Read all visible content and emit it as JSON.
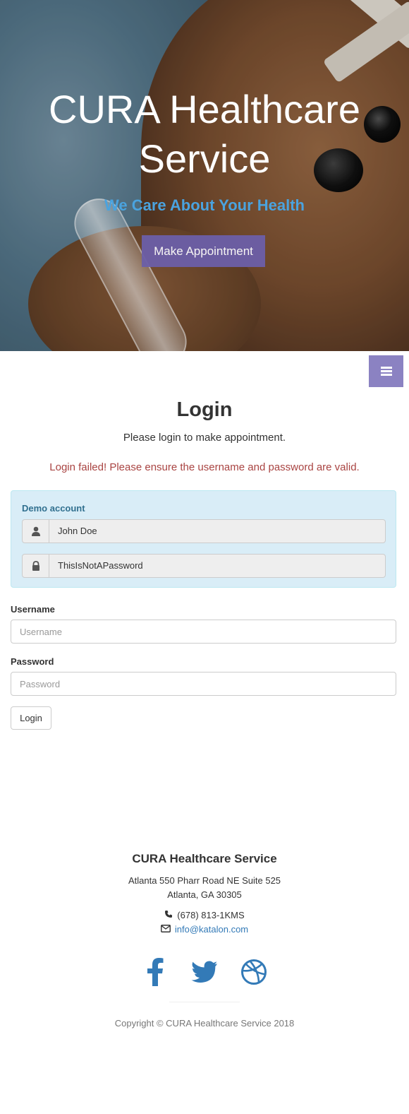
{
  "hero": {
    "title": "CURA Healthcare Service",
    "subtitle": "We Care About Your Health",
    "cta_label": "Make Appointment"
  },
  "login": {
    "title": "Login",
    "lead": "Please login to make appointment.",
    "error": "Login failed! Please ensure the username and password are valid.",
    "demo": {
      "title": "Demo account",
      "username_value": "John Doe",
      "password_value": "ThisIsNotAPassword"
    },
    "username_label": "Username",
    "username_placeholder": "Username",
    "password_label": "Password",
    "password_placeholder": "Password",
    "submit_label": "Login"
  },
  "footer": {
    "title": "CURA Healthcare Service",
    "address_line1": "Atlanta 550 Pharr Road NE Suite 525",
    "address_line2": "Atlanta, GA 30305",
    "phone": "(678) 813-1KMS",
    "email": "info@katalon.com",
    "copyright": "Copyright © CURA Healthcare Service 2018"
  },
  "icons": {
    "menu": "bars-icon",
    "user": "user-icon",
    "lock": "lock-icon",
    "phone": "phone-icon",
    "envelope": "envelope-icon",
    "facebook": "facebook-icon",
    "twitter": "twitter-icon",
    "dribbble": "dribbble-icon"
  },
  "colors": {
    "accent": "#6c5fa8",
    "menu_toggle": "#8b82c2",
    "subtitle": "#4aa3df",
    "error": "#a94442",
    "link": "#337ab7",
    "demo_bg": "#d9edf7"
  }
}
